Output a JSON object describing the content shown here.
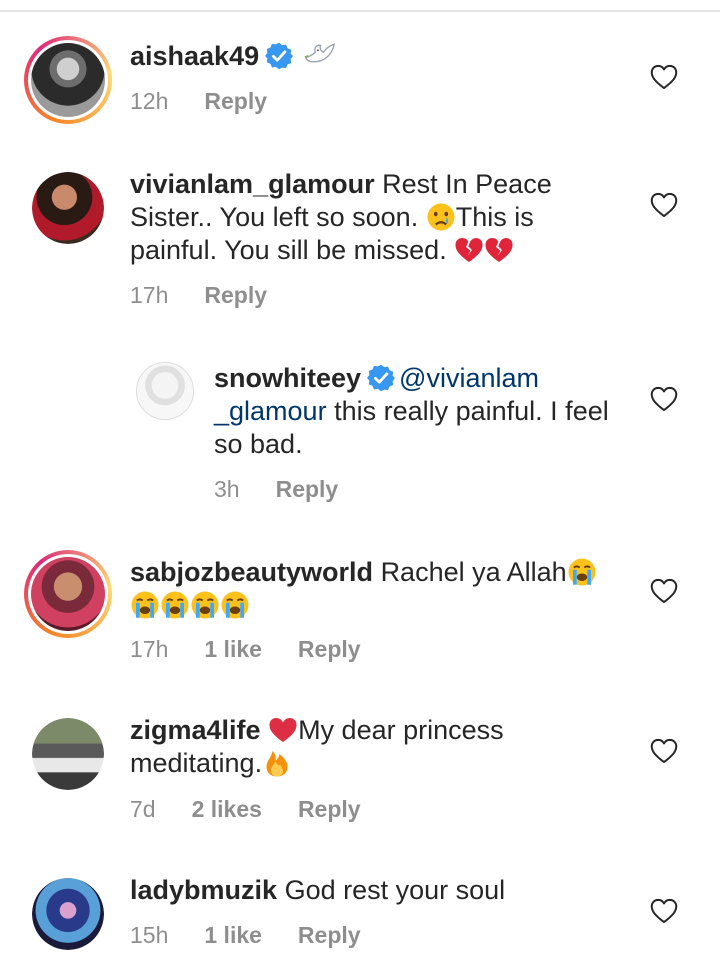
{
  "comments": [
    {
      "username": "aishaak49",
      "verified": true,
      "text": "",
      "time": "12h",
      "likes": "",
      "reply": "Reply"
    },
    {
      "username": "vivianlam_glamour",
      "verified": false,
      "text_parts": [
        "Rest In Peace Sister.. You left so soon. ",
        "This is painful. You sill be missed. "
      ],
      "time": "17h",
      "likes": "",
      "reply": "Reply"
    },
    {
      "username": "snowhiteey",
      "verified": true,
      "mention": "@vivianlam _glamour",
      "text": "this really painful. I feel so bad.",
      "time": "3h",
      "likes": "",
      "reply": "Reply"
    },
    {
      "username": "sabjozbeautyworld",
      "verified": false,
      "text": "Rachel ya Allah",
      "time": "17h",
      "likes": "1 like",
      "reply": "Reply"
    },
    {
      "username": "zigma4life",
      "verified": false,
      "text_parts": [
        "My dear  princess meditating."
      ],
      "time": "7d",
      "likes": "2 likes",
      "reply": "Reply"
    },
    {
      "username": "ladybmuzik",
      "verified": false,
      "text": "God rest your soul",
      "time": "15h",
      "likes": "1 like",
      "reply": "Reply"
    }
  ],
  "icons": {
    "verified": "verified-badge-icon",
    "like": "heart-outline-icon",
    "dove": "dove-emoji",
    "crying": "crying-face-emoji",
    "sob": "loudly-crying-face-emoji",
    "broken_heart": "broken-heart-emoji",
    "red_heart": "red-heart-emoji",
    "fire": "fire-emoji"
  },
  "colors": {
    "text": "#262626",
    "secondary": "#8e8e8e",
    "link": "#00376b",
    "verified": "#3897f0"
  }
}
